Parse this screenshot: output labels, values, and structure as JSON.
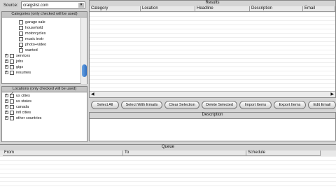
{
  "source": {
    "label": "Source:",
    "value": "craigslist.com"
  },
  "categories": {
    "header": "Categories (only checked will be used)",
    "items": [
      {
        "label": "garage sale",
        "checked": false
      },
      {
        "label": "household",
        "checked": false
      },
      {
        "label": "motorcycles",
        "checked": false
      },
      {
        "label": "music instr",
        "checked": false
      },
      {
        "label": "photo+video",
        "checked": false
      },
      {
        "label": "wanted",
        "checked": true
      },
      {
        "label": "services",
        "checked": false
      },
      {
        "label": "jobs",
        "checked": false
      },
      {
        "label": "gigs",
        "checked": false
      },
      {
        "label": "resumes",
        "checked": false
      }
    ]
  },
  "locations": {
    "header": "Locations (only checked will be used)",
    "items": [
      {
        "label": "us cities",
        "checked": true
      },
      {
        "label": "us states",
        "checked": false
      },
      {
        "label": "canada",
        "checked": false
      },
      {
        "label": "intl cities",
        "checked": false
      },
      {
        "label": "other countries",
        "checked": false
      }
    ]
  },
  "results": {
    "title": "Results",
    "columns": [
      "Category",
      "Location",
      "Headline",
      "Description",
      "Email"
    ]
  },
  "toolbar": {
    "select_all": "Select All",
    "select_with_emails": "Select With Emails",
    "clear_selection": "Clear Selection",
    "delete_selected": "Delete Selected",
    "import_items": "Import Items",
    "export_items": "Export Items",
    "edit_email": "Edit Email"
  },
  "description": {
    "title": "Description"
  },
  "queue": {
    "title": "Queue",
    "columns": [
      "From",
      "To",
      "Schedule"
    ]
  }
}
